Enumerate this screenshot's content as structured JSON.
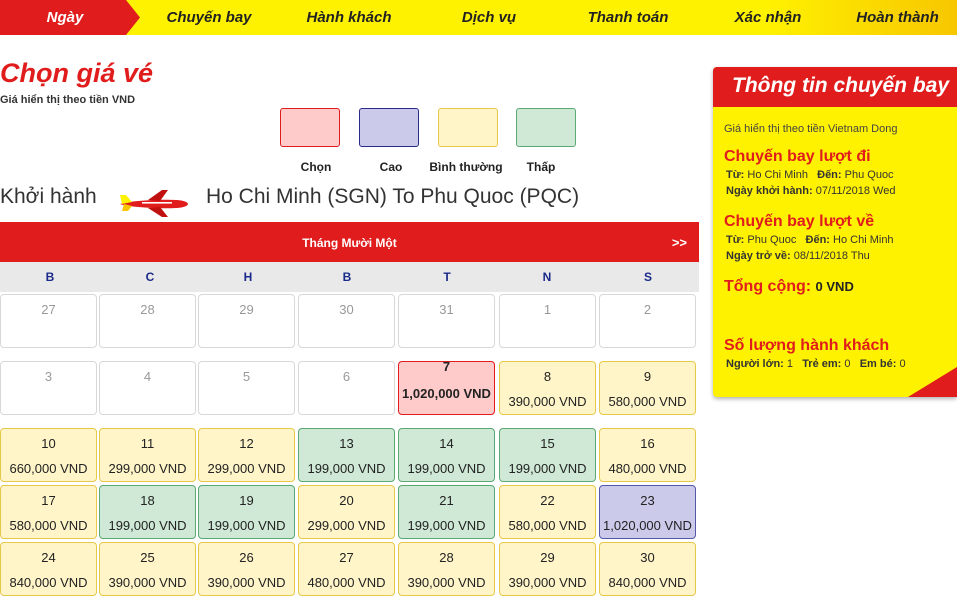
{
  "steps": [
    "Ngày",
    "Chuyến bay",
    "Hành khách",
    "Dịch vụ",
    "Thanh toán",
    "Xác nhận",
    "Hoàn thành"
  ],
  "title": "Chọn giá vé",
  "subtitle": "Giá hiển thị theo tiền VND",
  "legend": [
    {
      "label": "Chọn",
      "color": "#ffcaca",
      "border": "#e01c1c"
    },
    {
      "label": "Cao",
      "color": "#cccaeb",
      "border": "#2a2a8a"
    },
    {
      "label": "Bình thường",
      "color": "#fff5c9",
      "border": "#e7c94a"
    },
    {
      "label": "Thấp",
      "color": "#cfe9d6",
      "border": "#5aa874"
    }
  ],
  "depart_label": "Khởi hành",
  "route": "Ho Chi Minh (SGN) To Phu Quoc (PQC)",
  "calendar": {
    "month": "Tháng Mười Một",
    "next": ">>",
    "weekdays": [
      "B",
      "C",
      "H",
      "B",
      "T",
      "N",
      "S"
    ],
    "weeks": [
      [
        {
          "d": "27",
          "t": "empty"
        },
        {
          "d": "28",
          "t": "empty"
        },
        {
          "d": "29",
          "t": "empty"
        },
        {
          "d": "30",
          "t": "empty"
        },
        {
          "d": "31",
          "t": "empty"
        },
        {
          "d": "1",
          "t": "empty"
        },
        {
          "d": "2",
          "t": "empty"
        }
      ],
      [
        {
          "d": "3",
          "t": "empty"
        },
        {
          "d": "4",
          "t": "empty"
        },
        {
          "d": "5",
          "t": "empty"
        },
        {
          "d": "6",
          "t": "empty"
        },
        {
          "d": "7",
          "p": "1,020,000 VND",
          "t": "sel"
        },
        {
          "d": "8",
          "p": "390,000 VND",
          "t": "norm"
        },
        {
          "d": "9",
          "p": "580,000 VND",
          "t": "norm"
        }
      ],
      [
        {
          "d": "10",
          "p": "660,000 VND",
          "t": "norm"
        },
        {
          "d": "11",
          "p": "299,000 VND",
          "t": "norm"
        },
        {
          "d": "12",
          "p": "299,000 VND",
          "t": "norm"
        },
        {
          "d": "13",
          "p": "199,000 VND",
          "t": "low"
        },
        {
          "d": "14",
          "p": "199,000 VND",
          "t": "low"
        },
        {
          "d": "15",
          "p": "199,000 VND",
          "t": "low"
        },
        {
          "d": "16",
          "p": "480,000 VND",
          "t": "norm"
        }
      ],
      [
        {
          "d": "17",
          "p": "580,000 VND",
          "t": "norm"
        },
        {
          "d": "18",
          "p": "199,000 VND",
          "t": "low"
        },
        {
          "d": "19",
          "p": "199,000 VND",
          "t": "low"
        },
        {
          "d": "20",
          "p": "299,000 VND",
          "t": "norm"
        },
        {
          "d": "21",
          "p": "199,000 VND",
          "t": "low"
        },
        {
          "d": "22",
          "p": "580,000 VND",
          "t": "norm"
        },
        {
          "d": "23",
          "p": "1,020,000 VND",
          "t": "high"
        }
      ],
      [
        {
          "d": "24",
          "p": "840,000 VND",
          "t": "norm"
        },
        {
          "d": "25",
          "p": "390,000 VND",
          "t": "norm"
        },
        {
          "d": "26",
          "p": "390,000 VND",
          "t": "norm"
        },
        {
          "d": "27",
          "p": "480,000 VND",
          "t": "norm"
        },
        {
          "d": "28",
          "p": "390,000 VND",
          "t": "norm"
        },
        {
          "d": "29",
          "p": "390,000 VND",
          "t": "norm"
        },
        {
          "d": "30",
          "p": "840,000 VND",
          "t": "norm"
        }
      ]
    ]
  },
  "panel": {
    "title": "Thông tin chuyến bay",
    "note": "Giá hiển thị theo tiền Vietnam Dong",
    "outbound": {
      "heading": "Chuyến bay lượt đi",
      "from_label": "Từ:",
      "from": "Ho Chi Minh",
      "to_label": "Đến:",
      "to": "Phu Quoc",
      "date_label": "Ngày khởi hành:",
      "date": "07/11/2018 Wed"
    },
    "return": {
      "heading": "Chuyến bay lượt về",
      "from_label": "Từ:",
      "from": "Phu Quoc",
      "to_label": "Đến:",
      "to": "Ho Chi Minh",
      "date_label": "Ngày trở về:",
      "date": "08/11/2018 Thu"
    },
    "total_label": "Tổng cộng:",
    "total": "0 VND",
    "pax_heading": "Số lượng hành khách",
    "adult_label": "Người lớn:",
    "adult": "1",
    "child_label": "Trẻ em:",
    "child": "0",
    "infant_label": "Em bé:",
    "infant": "0"
  }
}
